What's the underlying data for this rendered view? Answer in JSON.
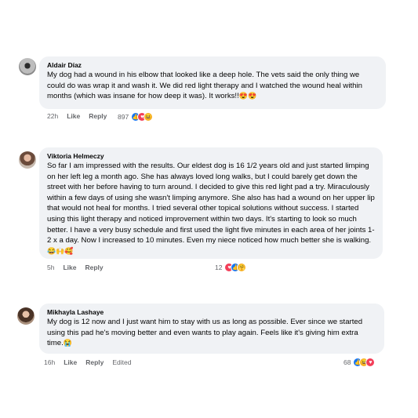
{
  "comments": [
    {
      "name": "Aldair Díaz",
      "text": "My dog had a wound in his elbow that looked like a deep hole. The vets said the only thing we could do was wrap it and wash it. We did red light therapy and I watched the wound heal within months (which was insane for how deep it was). It works!!",
      "emojis": "😍😍",
      "time": "22h",
      "like": "Like",
      "reply": "Reply",
      "reaction_count": "897",
      "reactions": [
        "like",
        "love",
        "haha"
      ]
    },
    {
      "name": "Viktoria Helmeczy",
      "text": "So far I am impressed with the results. Our eldest dog is 16 1/2 years old and just started limping on her left leg a month ago. She has always loved long walks, but I could barely get down the street with her before having to turn around. I decided to give this red light pad a try. Miraculously within a few days of using she wasn't limping anymore. She also has had a wound on her upper lip that would not heal for months. I tried several other topical solutions without success. I started using this light therapy and noticed improvement within two days. It's starting to look so much better. I have a very busy schedule and first used the light five minutes in each area of her joints 1-2 x a day. Now I increased to 10 minutes. Even my niece noticed how much better she is walking.",
      "emojis": "😂🙌🥰",
      "time": "5h",
      "like": "Like",
      "reply": "Reply",
      "reaction_count": "12",
      "reactions": [
        "love",
        "like",
        "care"
      ]
    },
    {
      "name": "Mikhayla Lashaye",
      "text": "My dog is 12 now and I just want him to stay with us as long as possible. Ever since we started using this pad he's moving better and even wants to play again. Feels like it's giving him extra time.",
      "emojis": "😭",
      "time": "16h",
      "like": "Like",
      "reply": "Reply",
      "edited": "Edited",
      "reaction_count": "68",
      "reactions": [
        "like",
        "haha",
        "love"
      ]
    }
  ]
}
